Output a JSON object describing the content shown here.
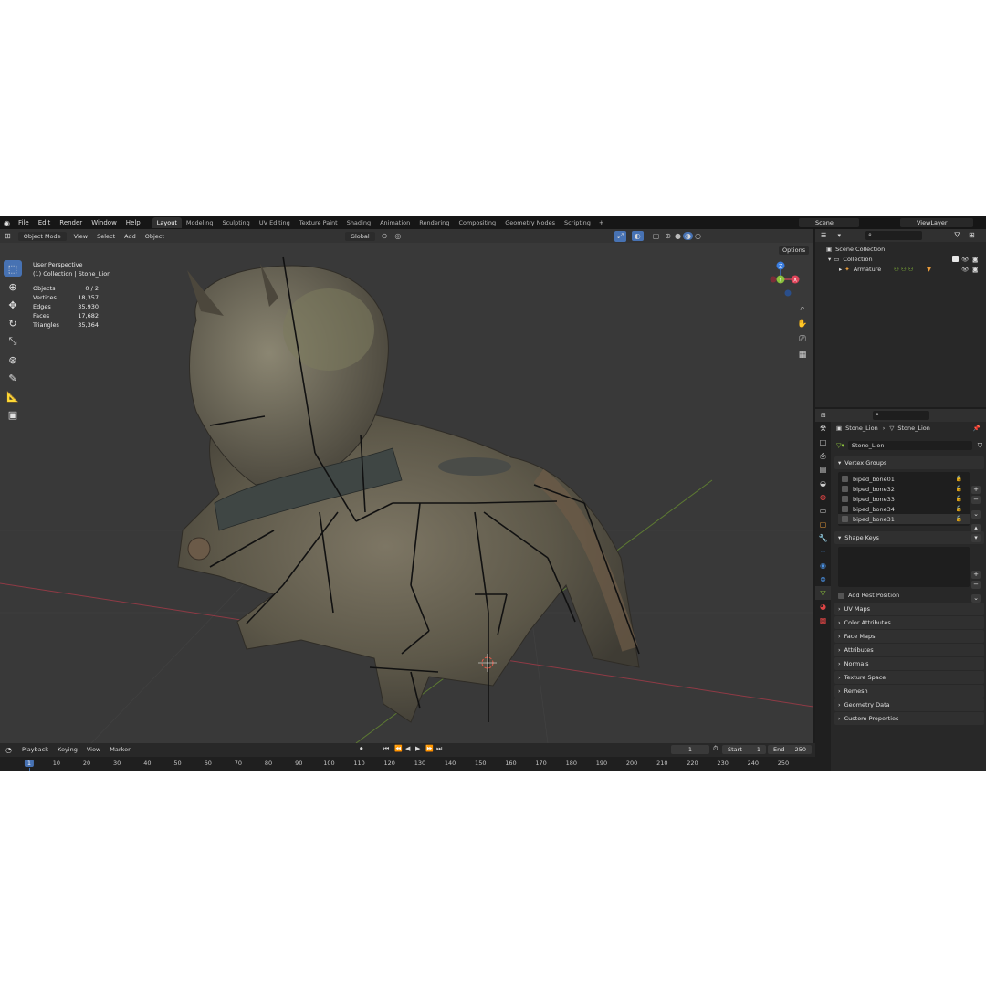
{
  "menu": [
    "File",
    "Edit",
    "Render",
    "Window",
    "Help"
  ],
  "workspaces": [
    "Layout",
    "Modeling",
    "Sculpting",
    "UV Editing",
    "Texture Paint",
    "Shading",
    "Animation",
    "Rendering",
    "Compositing",
    "Geometry Nodes",
    "Scripting"
  ],
  "workspace_add": "+",
  "scene": "Scene",
  "view_layer": "ViewLayer",
  "viewport": {
    "mode": "Object Mode",
    "menus": [
      "View",
      "Select",
      "Add",
      "Object"
    ],
    "orientation": "Global",
    "options": "Options",
    "view_name": "User Perspective",
    "collection_info": "(1) Collection | Stone_Lion",
    "stats": [
      {
        "k": "Objects",
        "v": "0 / 2"
      },
      {
        "k": "Vertices",
        "v": "18,357"
      },
      {
        "k": "Edges",
        "v": "35,930"
      },
      {
        "k": "Faces",
        "v": "17,682"
      },
      {
        "k": "Triangles",
        "v": "35,364"
      }
    ],
    "gizmo": {
      "x": "X",
      "y": "Y",
      "z": "Z"
    }
  },
  "timeline": {
    "menus": [
      "Playback",
      "Keying",
      "View",
      "Marker"
    ],
    "current_frame": "1",
    "start_label": "Start",
    "start": "1",
    "end_label": "End",
    "end": "250",
    "ticks": [
      "1",
      "10",
      "20",
      "30",
      "40",
      "50",
      "60",
      "70",
      "80",
      "90",
      "100",
      "110",
      "120",
      "130",
      "140",
      "150",
      "160",
      "170",
      "180",
      "190",
      "200",
      "210",
      "220",
      "230",
      "240",
      "250"
    ]
  },
  "outliner": {
    "rows": [
      "Scene Collection",
      "Collection",
      "Armature"
    ]
  },
  "properties": {
    "breadcrumb_object": "Stone_Lion",
    "breadcrumb_data": "Stone_Lion",
    "mesh_name": "Stone_Lion",
    "vertex_groups_label": "Vertex Groups",
    "vertex_groups": [
      "biped_bone01",
      "biped_bone32",
      "biped_bone33",
      "biped_bone34",
      "biped_bone31"
    ],
    "shape_keys_label": "Shape Keys",
    "add_rest_position": "Add Rest Position",
    "panels": [
      "UV Maps",
      "Color Attributes",
      "Face Maps",
      "Attributes",
      "Normals",
      "Texture Space",
      "Remesh",
      "Geometry Data",
      "Custom Properties"
    ]
  },
  "colors": {
    "accent": "#4772b3",
    "axis_x": "#e0455a",
    "axis_y": "#8bc13c",
    "axis_z": "#3b7ee0"
  }
}
